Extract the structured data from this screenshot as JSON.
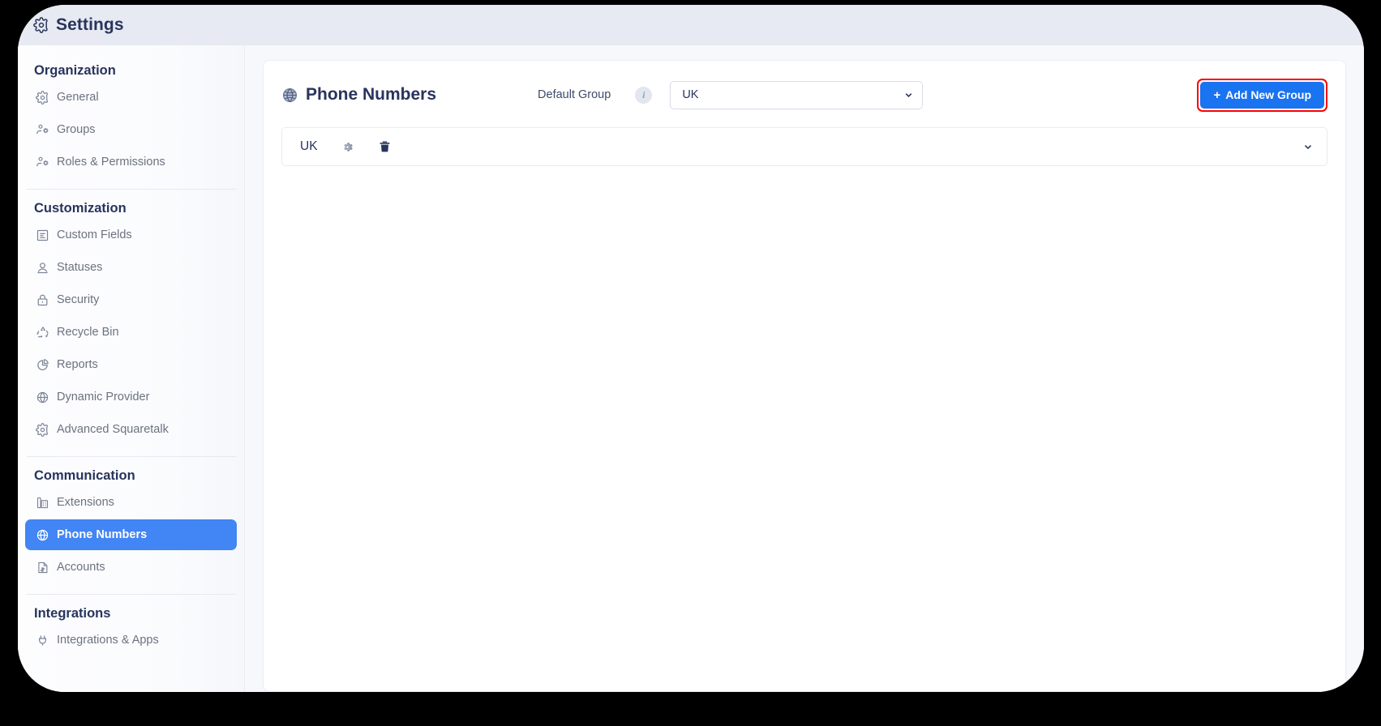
{
  "window": {
    "titlebar": {
      "icon": "gear-icon",
      "title": "Settings"
    }
  },
  "sidebar": {
    "sections": [
      {
        "title": "Organization",
        "items": [
          {
            "label": "General",
            "icon": "gear-icon",
            "active": false
          },
          {
            "label": "Groups",
            "icon": "users-gear-icon",
            "active": false
          },
          {
            "label": "Roles & Permissions",
            "icon": "users-gear-icon",
            "active": false
          }
        ]
      },
      {
        "title": "Customization",
        "items": [
          {
            "label": "Custom Fields",
            "icon": "form-fields-icon",
            "active": false
          },
          {
            "label": "Statuses",
            "icon": "user-status-icon",
            "active": false
          },
          {
            "label": "Security",
            "icon": "lock-icon",
            "active": false
          },
          {
            "label": "Recycle Bin",
            "icon": "recycle-icon",
            "active": false
          },
          {
            "label": "Reports",
            "icon": "pie-chart-icon",
            "active": false
          },
          {
            "label": "Dynamic Provider",
            "icon": "globe-icon",
            "active": false
          },
          {
            "label": "Advanced Squaretalk",
            "icon": "gear-icon",
            "active": false
          }
        ]
      },
      {
        "title": "Communication",
        "items": [
          {
            "label": "Extensions",
            "icon": "desk-phone-icon",
            "active": false
          },
          {
            "label": "Phone Numbers",
            "icon": "globe-icon",
            "active": true
          },
          {
            "label": "Accounts",
            "icon": "invoice-icon",
            "active": false
          }
        ]
      },
      {
        "title": "Integrations",
        "items": [
          {
            "label": "Integrations & Apps",
            "icon": "plug-icon",
            "active": false
          }
        ]
      }
    ]
  },
  "main": {
    "page_title": "Phone Numbers",
    "page_title_icon": "globe-icon",
    "default_group_label": "Default Group",
    "info_badge": "i",
    "group_select": {
      "value": "UK",
      "options": [
        "UK"
      ]
    },
    "add_new_group_button": {
      "plus": "+",
      "label": "Add New Group",
      "highlight_color": "#ff0000",
      "background_color": "#1a73f0"
    },
    "groups": [
      {
        "name": "UK",
        "settings_icon": "gear-icon",
        "delete_icon": "trash-icon",
        "expand_icon": "chevron-down-icon"
      }
    ]
  },
  "colors": {
    "accent": "#4285f4",
    "button_blue": "#1a73f0",
    "highlight_red": "#ff0000",
    "title_navy": "#27345c",
    "titlebar_bg": "#e7eaf2",
    "main_bg": "#f7f8fc"
  }
}
